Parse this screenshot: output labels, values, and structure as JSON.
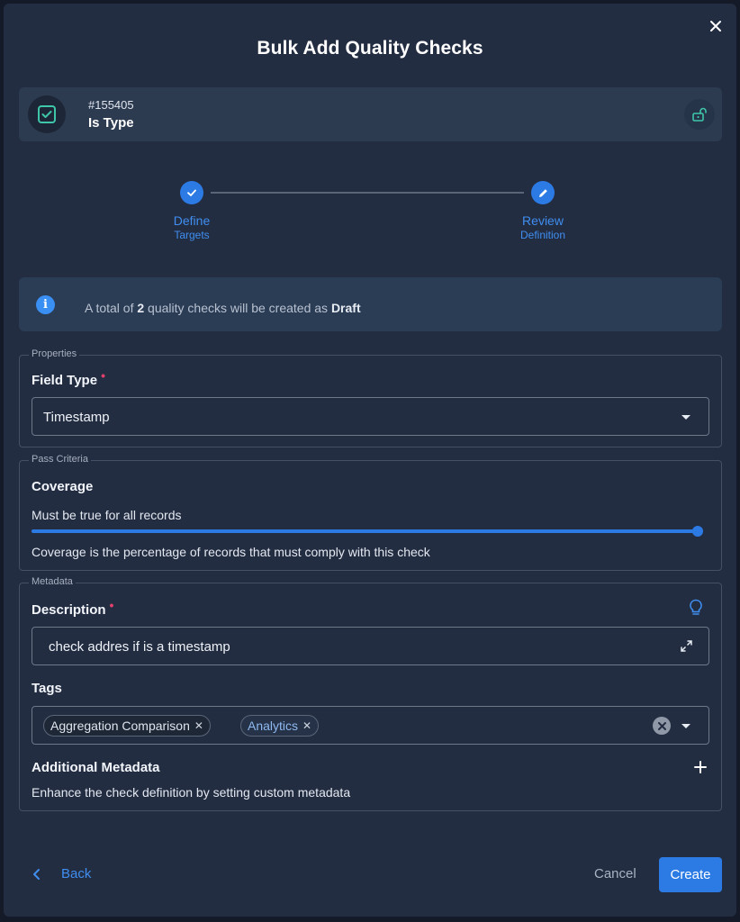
{
  "modal": {
    "title": "Bulk Add Quality Checks"
  },
  "check": {
    "id": "#155405",
    "name": "Is Type"
  },
  "stepper": {
    "steps": [
      {
        "line1": "Define",
        "line2": "Targets",
        "state": "completed"
      },
      {
        "line1": "Review",
        "line2": "Definition",
        "state": "active"
      }
    ]
  },
  "info": {
    "prefix": "A total of ",
    "count": "2",
    "middle": " quality checks will be created as ",
    "status": "Draft"
  },
  "properties": {
    "legend": "Properties",
    "field_type_label": "Field Type",
    "field_type_value": "Timestamp"
  },
  "pass_criteria": {
    "legend": "Pass Criteria",
    "coverage_label": "Coverage",
    "coverage_text": "Must be true for all records",
    "coverage_value_fraction": 1.0,
    "coverage_help": "Coverage is the percentage of records that must comply with this check"
  },
  "metadata": {
    "legend": "Metadata",
    "description_label": "Description",
    "description_value": "check addres if is a timestamp",
    "tags_label": "Tags",
    "tags": [
      "Aggregation Comparison",
      "Analytics"
    ],
    "additional_label": "Additional Metadata",
    "additional_help": "Enhance the check definition by setting custom metadata"
  },
  "footer": {
    "back_label": "Back",
    "cancel_label": "Cancel",
    "create_label": "Create"
  },
  "colors": {
    "accent": "#2c7be5",
    "background": "#232d42",
    "required": "#e0406b"
  }
}
